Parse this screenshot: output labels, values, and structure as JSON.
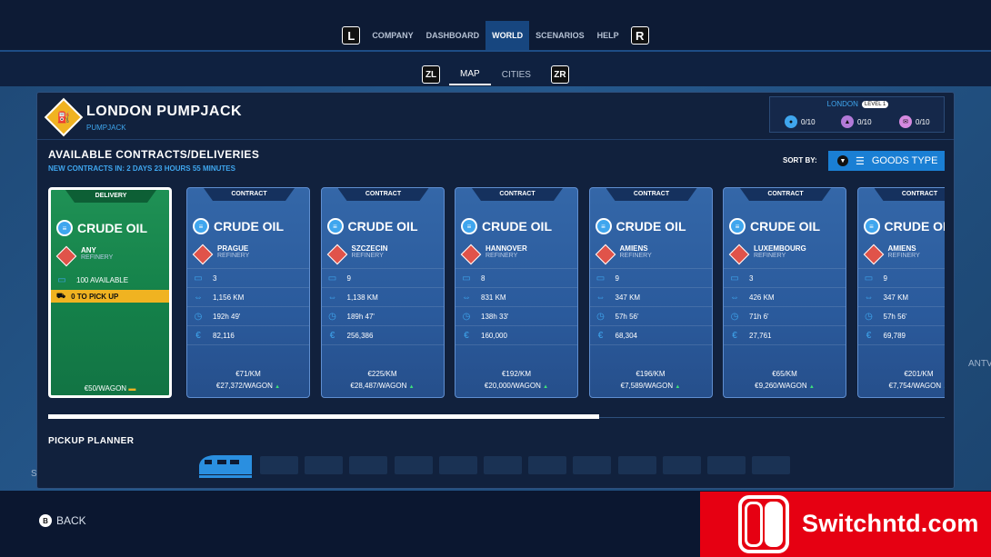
{
  "nav": {
    "left_button": "L",
    "right_button": "R",
    "items": [
      "COMPANY",
      "DASHBOARD",
      "WORLD",
      "SCENARIOS",
      "HELP"
    ],
    "active": "WORLD"
  },
  "subnav": {
    "left_button": "ZL",
    "right_button": "ZR",
    "items": [
      "MAP",
      "CITIES"
    ],
    "active": "MAP"
  },
  "header": {
    "title": "LONDON PUMPJACK",
    "subtitle": "PUMPJACK",
    "city": "LONDON",
    "level": "LEVEL 1",
    "stats": [
      "0/10",
      "0/10",
      "0/10"
    ]
  },
  "section": {
    "title": "AVAILABLE CONTRACTS/DELIVERIES",
    "subtitle": "NEW CONTRACTS IN: 2 DAYS 23 HOURS 55 MINUTES",
    "sort_label": "SORT BY:",
    "sort_value": "GOODS TYPE"
  },
  "delivery": {
    "tag": "DELIVERY",
    "cargo": "CRUDE OIL",
    "dest": "ANY",
    "dest_type": "REFINERY",
    "available": "100 AVAILABLE",
    "pickup": "0 TO PICK UP",
    "price": "€50/WAGON"
  },
  "contracts": [
    {
      "tag": "CONTRACT",
      "cargo": "CRUDE OIL",
      "city": "PRAGUE",
      "type": "REFINERY",
      "wagons": "3",
      "distance": "1,156 KM",
      "time": "192h 49'",
      "money": "82,116",
      "per_km": "€71/KM",
      "per_wagon": "€27,372/WAGON"
    },
    {
      "tag": "CONTRACT",
      "cargo": "CRUDE OIL",
      "city": "SZCZECIN",
      "type": "REFINERY",
      "wagons": "9",
      "distance": "1,138 KM",
      "time": "189h 47'",
      "money": "256,386",
      "per_km": "€225/KM",
      "per_wagon": "€28,487/WAGON"
    },
    {
      "tag": "CONTRACT",
      "cargo": "CRUDE OIL",
      "city": "HANNOVER",
      "type": "REFINERY",
      "wagons": "8",
      "distance": "831 KM",
      "time": "138h 33'",
      "money": "160,000",
      "per_km": "€192/KM",
      "per_wagon": "€20,000/WAGON"
    },
    {
      "tag": "CONTRACT",
      "cargo": "CRUDE OIL",
      "city": "AMIENS",
      "type": "REFINERY",
      "wagons": "9",
      "distance": "347 KM",
      "time": "57h 56'",
      "money": "68,304",
      "per_km": "€196/KM",
      "per_wagon": "€7,589/WAGON"
    },
    {
      "tag": "CONTRACT",
      "cargo": "CRUDE OIL",
      "city": "LUXEMBOURG",
      "type": "REFINERY",
      "wagons": "3",
      "distance": "426 KM",
      "time": "71h 6'",
      "money": "27,761",
      "per_km": "€65/KM",
      "per_wagon": "€9,260/WAGON"
    },
    {
      "tag": "CONTRACT",
      "cargo": "CRUDE OIL",
      "city": "AMIENS",
      "type": "REFINERY",
      "wagons": "9",
      "distance": "347 KM",
      "time": "57h 56'",
      "money": "69,789",
      "per_km": "€201/KM",
      "per_wagon": "€7,754/WAGON"
    }
  ],
  "planner": {
    "title": "PICKUP PLANNER"
  },
  "footer": {
    "back_button": "B",
    "back_label": "BACK"
  },
  "edge_labels": {
    "right": "ANTV",
    "left": "S"
  },
  "watermark": {
    "text": "Switchntd.com"
  },
  "colors": {
    "accent": "#1a7fd4",
    "selected_card": "#15824a",
    "warning": "#f0b321",
    "link": "#3fa6ee",
    "watermark": "#e60012"
  }
}
